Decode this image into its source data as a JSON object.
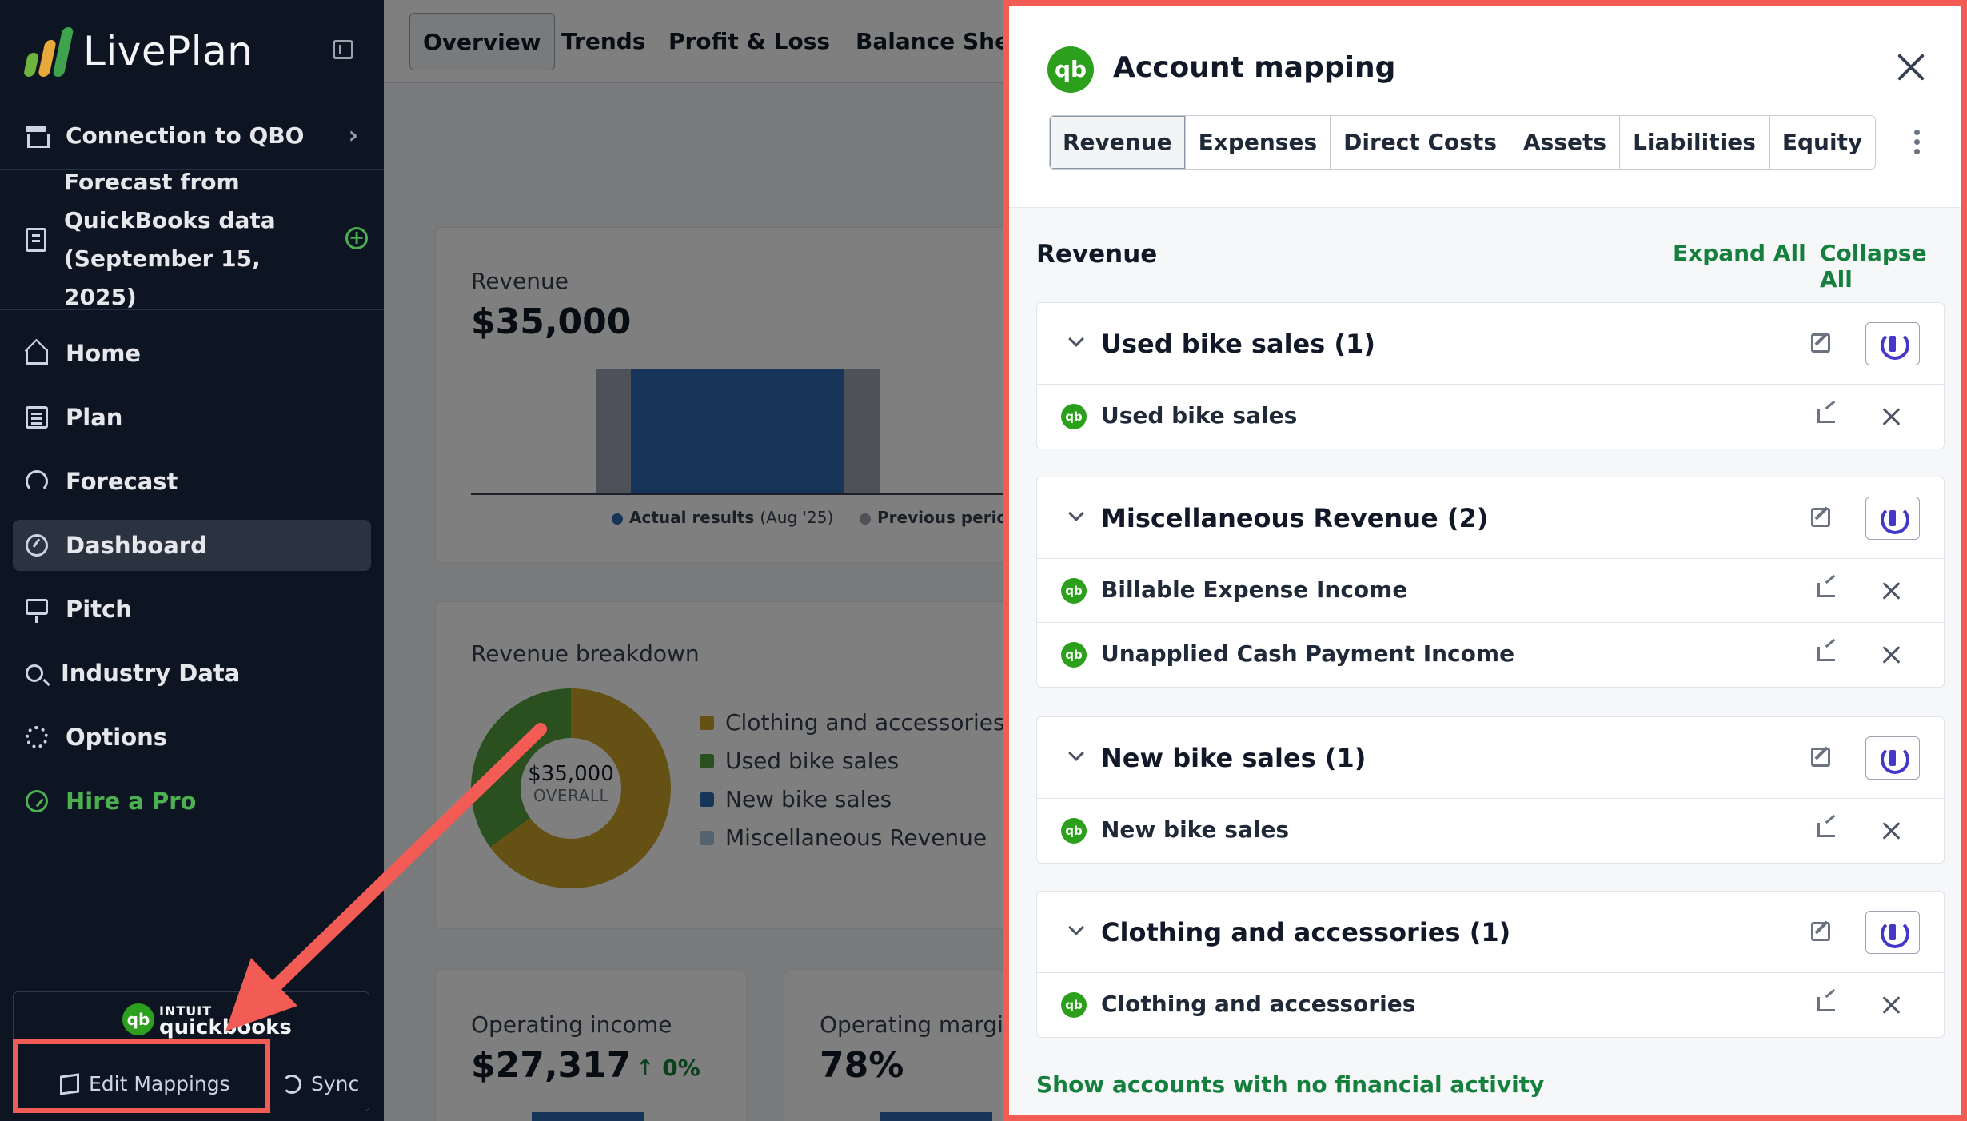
{
  "sidebar": {
    "brand": "LivePlan",
    "connection": "Connection to QBO",
    "forecast_lines": [
      "Forecast from",
      "QuickBooks data",
      "(September 15, 2025)"
    ],
    "nav": [
      {
        "label": "Home",
        "icon": "home-icon"
      },
      {
        "label": "Plan",
        "icon": "plan-icon"
      },
      {
        "label": "Forecast",
        "icon": "forecast-icon"
      },
      {
        "label": "Dashboard",
        "icon": "dashboard-icon",
        "active": true
      },
      {
        "label": "Pitch",
        "icon": "pitch-icon"
      },
      {
        "label": "Industry Data",
        "icon": "industry-data-icon"
      },
      {
        "label": "Options",
        "icon": "gear-icon"
      },
      {
        "label": "Hire a Pro",
        "icon": "compass-icon"
      }
    ],
    "quickbooks": {
      "intuit": "INTUIT",
      "name": "quickbooks",
      "badge": "qb"
    },
    "edit_mappings": "Edit Mappings",
    "sync": "Sync"
  },
  "main": {
    "tabs": [
      "Overview",
      "Trends",
      "Profit & Loss",
      "Balance Sheet"
    ],
    "revenue": {
      "label": "Revenue",
      "value": "$35,000",
      "legend_actual": "Actual results",
      "legend_actual_period": "(Aug '25)",
      "legend_previous": "Previous period (J"
    },
    "breakdown": {
      "label": "Revenue breakdown",
      "center_value": "$35,000",
      "center_caption": "OVERALL",
      "legend": [
        "Clothing and accessories",
        "Used bike sales",
        "New bike sales",
        "Miscellaneous Revenue"
      ]
    },
    "operating_income": {
      "label": "Operating income",
      "value": "$27,317",
      "change": "0%"
    },
    "operating_margin": {
      "label": "Operating margin",
      "value": "78%"
    }
  },
  "chart_data": [
    {
      "type": "bar",
      "title": "Revenue",
      "categories": [
        "Actual results (Aug '25)",
        "Previous period"
      ],
      "values": [
        35000,
        35000
      ],
      "colors": [
        "#2d6bb3",
        "#9ca3af"
      ]
    },
    {
      "type": "pie",
      "title": "Revenue breakdown",
      "categories": [
        "Clothing and accessories",
        "Used bike sales",
        "New bike sales",
        "Miscellaneous Revenue"
      ],
      "values": [
        0.65,
        0.35,
        0.0,
        0.0
      ],
      "colors": [
        "#c9a227",
        "#55a141",
        "#2d6bb3",
        "#a9c6dd"
      ]
    }
  ],
  "panel": {
    "title": "Account mapping",
    "badge": "qb",
    "tabs": [
      "Revenue",
      "Expenses",
      "Direct Costs",
      "Assets",
      "Liabilities",
      "Equity"
    ],
    "section_title": "Revenue",
    "expand_all": "Expand All",
    "collapse_all": "Collapse All",
    "groups": [
      {
        "title": "Used bike sales (1)",
        "accounts": [
          "Used bike sales"
        ]
      },
      {
        "title": "Miscellaneous Revenue (2)",
        "accounts": [
          "Billable Expense Income",
          "Unapplied Cash Payment Income"
        ]
      },
      {
        "title": "New bike sales (1)",
        "accounts": [
          "New bike sales"
        ]
      },
      {
        "title": "Clothing and accessories (1)",
        "accounts": [
          "Clothing and accessories"
        ]
      }
    ],
    "show_link": "Show accounts with no financial activity"
  },
  "colors": {
    "annotation": "#f25c54",
    "brand_green": "#15803d",
    "qb_green": "#2ca01c",
    "sync_purple": "#4338ca",
    "sidebar_bg": "#0d1523"
  }
}
